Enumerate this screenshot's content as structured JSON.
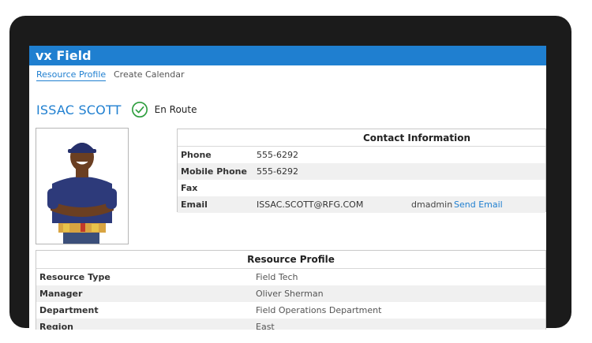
{
  "app": {
    "title": "vx Field"
  },
  "tabs": [
    {
      "label": "Resource Profile",
      "active": true
    },
    {
      "label": "Create Calendar",
      "active": false
    }
  ],
  "person": {
    "name": "ISSAC SCOTT",
    "status": "En Route",
    "status_icon": "check-circle-icon"
  },
  "contact": {
    "title": "Contact Information",
    "rows": [
      {
        "label": "Phone",
        "value": "555-6292"
      },
      {
        "label": "Mobile Phone",
        "value": "555-6292"
      },
      {
        "label": "Fax",
        "value": ""
      },
      {
        "label": "Email",
        "value": "ISSAC.SCOTT@RFG.COM",
        "user": "dmadmin",
        "link": "Send Email"
      }
    ]
  },
  "profile": {
    "title": "Resource Profile",
    "rows": [
      {
        "label": "Resource Type",
        "value": "Field Tech"
      },
      {
        "label": "Manager",
        "value": "Oliver Sherman"
      },
      {
        "label": "Department",
        "value": "Field Operations Department"
      },
      {
        "label": "Region",
        "value": "East"
      }
    ]
  },
  "colors": {
    "accent": "#1f7fd0",
    "status": "#2e9e3e",
    "bezel": "#1b1b1b"
  }
}
